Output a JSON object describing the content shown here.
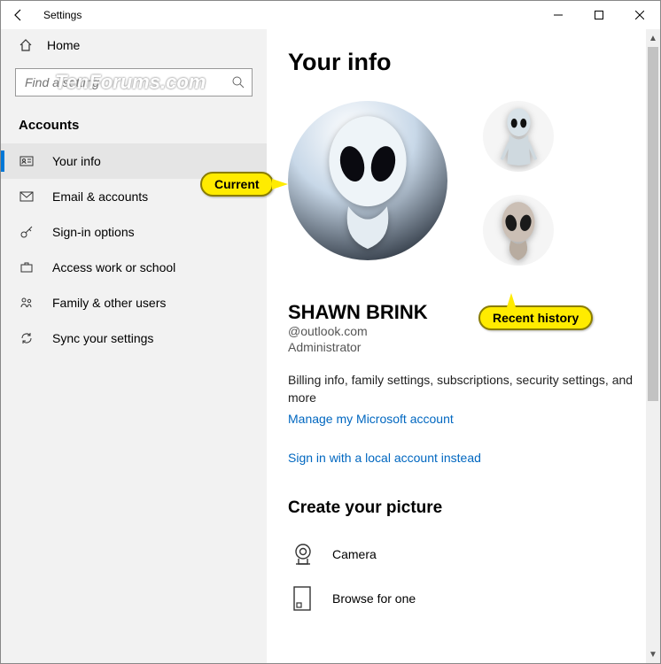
{
  "titlebar": {
    "title": "Settings"
  },
  "sidebar": {
    "home": "Home",
    "search_placeholder": "Find a setting",
    "section": "Accounts",
    "items": [
      {
        "label": "Your info"
      },
      {
        "label": "Email & accounts"
      },
      {
        "label": "Sign-in options"
      },
      {
        "label": "Access work or school"
      },
      {
        "label": "Family & other users"
      },
      {
        "label": "Sync your settings"
      }
    ]
  },
  "main": {
    "heading": "Your info",
    "username": "SHAWN BRINK",
    "email": "@outlook.com",
    "role": "Administrator",
    "billing_text": "Billing info, family settings, subscriptions, security settings, and more",
    "manage_link": "Manage my Microsoft account",
    "local_link": "Sign in with a local account instead",
    "create_heading": "Create your picture",
    "camera": "Camera",
    "browse": "Browse for one"
  },
  "callouts": {
    "current": "Current",
    "recent": "Recent history"
  },
  "watermark": "TenForums.com"
}
